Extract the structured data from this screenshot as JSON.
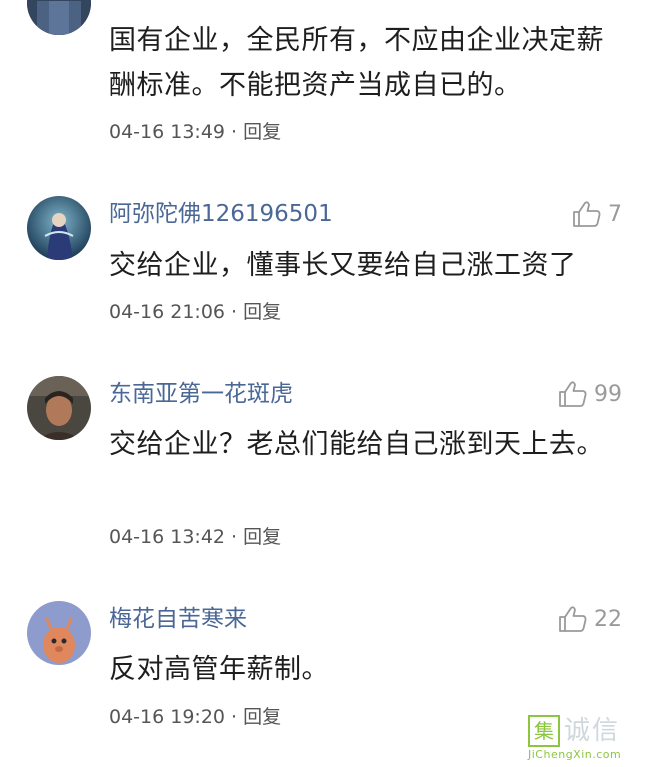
{
  "comments": [
    {
      "username": "",
      "text": "国有企业，全民所有，不应由企业决定薪酬标准。不能把资产当成自已的。",
      "time": "04-16 13:49",
      "dot": "·",
      "reply": "回复",
      "likes": ""
    },
    {
      "username": "阿弥陀佛126196501",
      "text": "交给企业，懂事长又要给自己涨工资了",
      "time": "04-16 21:06",
      "dot": "·",
      "reply": "回复",
      "likes": "7"
    },
    {
      "username": "东南亚第一花斑虎",
      "text": "交给企业？老总们能给自己涨到天上去。",
      "time": "04-16 13:42",
      "dot": "·",
      "reply": "回复",
      "likes": "99"
    },
    {
      "username": "梅花自苦寒来",
      "text": "反对高管年薪制。",
      "time": "04-16 19:20",
      "dot": "·",
      "reply": "回复",
      "likes": "22"
    }
  ],
  "watermark": {
    "logo": "集",
    "chinese": "诚信",
    "english": "JiChengXin.com"
  },
  "colors": {
    "username": "#4a6796",
    "text": "#1e1e1e",
    "meta": "#555555",
    "like": "#9a9a9a"
  },
  "icons": {
    "like": "thumbs-up-icon"
  }
}
